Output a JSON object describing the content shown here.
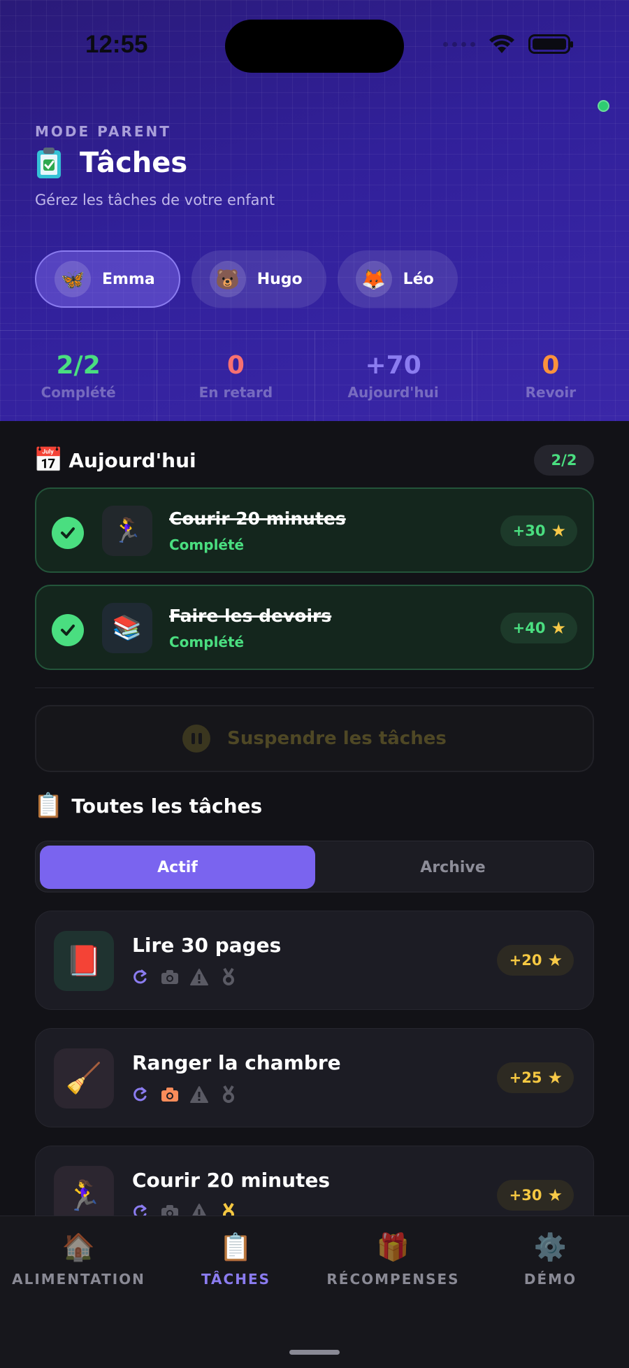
{
  "status": {
    "time": "12:55"
  },
  "header": {
    "mode_label": "MODE PARENT",
    "title": "Tâches",
    "subtitle": "Gérez les tâches de votre enfant"
  },
  "profiles": [
    {
      "name": "Emma",
      "avatar": "🦋",
      "active": true
    },
    {
      "name": "Hugo",
      "avatar": "🐻",
      "active": false
    },
    {
      "name": "Léo",
      "avatar": "🦊",
      "active": false
    }
  ],
  "stats": [
    {
      "value": "2/2",
      "label": "Complété",
      "color": "#4ade80"
    },
    {
      "value": "0",
      "label": "En retard",
      "color": "#f87171"
    },
    {
      "value": "+70",
      "label": "Aujourd'hui",
      "color": "#8b7cf0"
    },
    {
      "value": "0",
      "label": "Revoir",
      "color": "#fb923c"
    }
  ],
  "today": {
    "icon": "📅",
    "title": "Aujourd'hui",
    "count": "2/2",
    "tasks": [
      {
        "emoji": "🏃‍♀️",
        "title": "Courir 20 minutes",
        "status": "Complété",
        "points": "+30"
      },
      {
        "emoji": "📚",
        "title": "Faire les devoirs",
        "status": "Complété",
        "points": "+40"
      }
    ]
  },
  "suspend_label": "Suspendre les tâches",
  "all_tasks": {
    "icon": "📋",
    "title": "Toutes les tâches",
    "tabs": {
      "active": "Actif",
      "archive": "Archive"
    },
    "tasks": [
      {
        "emoji": "📕",
        "title": "Lire 30 pages",
        "points": "+20",
        "icon_bg": "#1f3330",
        "photo_active": false,
        "medal_active": false
      },
      {
        "emoji": "🧹",
        "title": "Ranger la chambre",
        "points": "+25",
        "icon_bg": "#2c2630",
        "photo_active": true,
        "medal_active": false
      },
      {
        "emoji": "🏃‍♀️",
        "title": "Courir 20 minutes",
        "points": "+30",
        "icon_bg": "#2c2630",
        "photo_active": false,
        "medal_active": true
      }
    ]
  },
  "nav": [
    {
      "label": "ALIMENTATION",
      "icon": "🏠"
    },
    {
      "label": "TÂCHES",
      "icon": "📋"
    },
    {
      "label": "RÉCOMPENSES",
      "icon": "🎁"
    },
    {
      "label": "DÉMO",
      "icon": "⚙️"
    }
  ],
  "colors": {
    "accent": "#7a64ef",
    "success": "#4ade80",
    "gold": "#f5c842"
  }
}
